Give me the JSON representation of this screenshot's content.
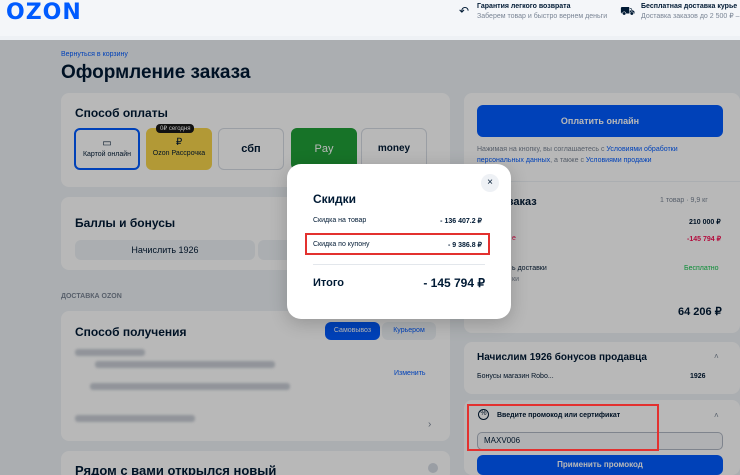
{
  "header": {
    "logo": "OZON",
    "guarantee_title": "Гарантия легкого возврата",
    "guarantee_sub": "Заберем товар и быстро вернем деньги",
    "delivery_title": "Бесплатная доставка курье",
    "delivery_sub": "Доставка заказов до 2 500 ₽ –"
  },
  "breadcrumb": "Вернуться в корзину",
  "page_title": "Оформление заказа",
  "payment": {
    "title": "Способ оплаты",
    "options": [
      {
        "label": "Картой онлайн",
        "icon": "card-icon"
      },
      {
        "label": "Ozon Рассрочка",
        "badge": "0₽ сегодня",
        "icon": "ruble-icon"
      },
      {
        "label": "сбп",
        "icon": "sbp-icon"
      },
      {
        "label": "Pay",
        "icon": "check-circle-icon"
      },
      {
        "label": "money",
        "icon": "yoomoney-icon"
      }
    ]
  },
  "bonuses": {
    "title": "Баллы и бонусы",
    "accrue_button": "Начислить 1926"
  },
  "delivery": {
    "section_label": "ДОСТАВКА OZON",
    "title": "Способ получения",
    "tab_pickup": "Самовывоз",
    "tab_courier": "Курьером",
    "change_link": "Изменить"
  },
  "bottom_card_title": "Рядом с вами открылся новый",
  "right": {
    "pay_button": "Оплатить онлайн",
    "agreement_1": "Нажимая на кнопку, вы соглашаетесь с",
    "agreement_link_1": "Условиями обработки персональных данных",
    "agreement_2": ", а также с",
    "agreement_link_2": "Условиями продажи",
    "order_title": "заказ",
    "order_count": "1 товар · 9,9 кг",
    "goods_price": "210 000 ₽",
    "discount_price": "-145 794 ₽",
    "discount_label": "е",
    "delivery_label": "ь доставки",
    "delivery_value": "Бесплатно",
    "delivery_sub": "ки",
    "total": "64 206 ₽",
    "bonus_title": "Начислим 1926 бонусов продавца",
    "bonus_row_label": "Бонусы магазин Robo...",
    "bonus_row_value": "1926",
    "promo_title": "Введите промокод или сертификат",
    "promo_value": "MAXV006",
    "promo_button": "Применить промокод"
  },
  "modal": {
    "title": "Скидки",
    "row1_label": "Скидка на товар",
    "row1_value": "- 136 407.2 ₽",
    "row2_label": "Скидка по купону",
    "row2_value": "- 9 386.8 ₽",
    "total_label": "Итого",
    "total_value": "- 145 794 ₽",
    "close": "×"
  },
  "colors": {
    "accent": "#005bff",
    "highlight": "#e3312f",
    "discount": "#f91155",
    "free": "#10c44c"
  }
}
